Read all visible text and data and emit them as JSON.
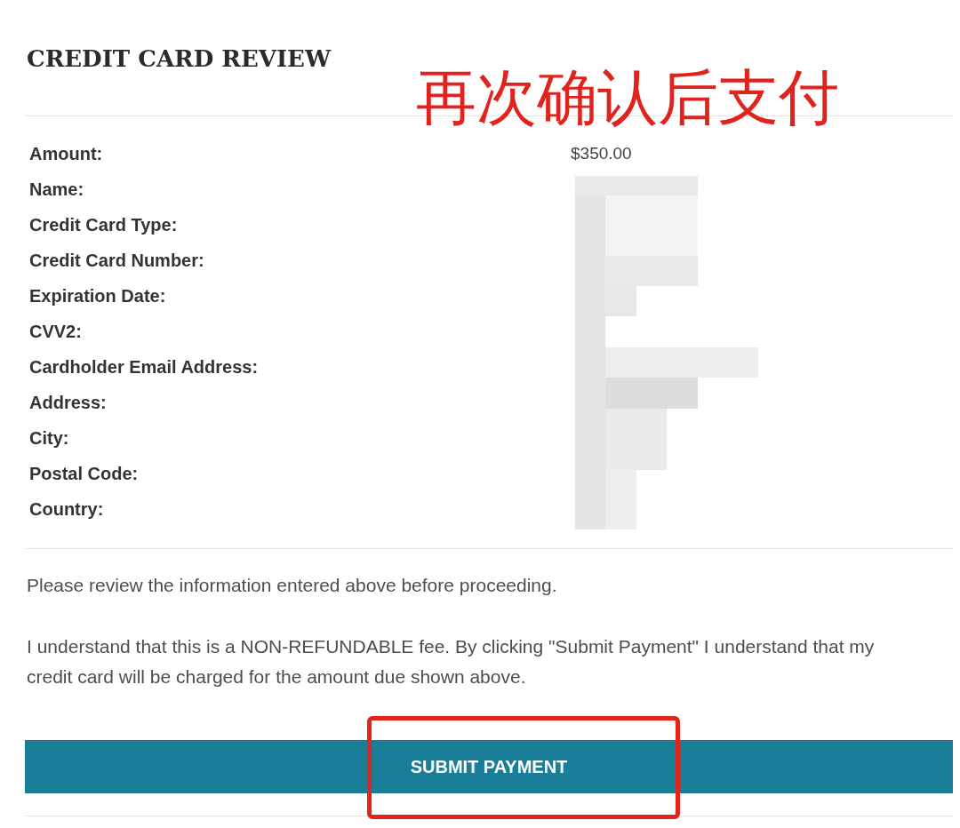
{
  "header": {
    "title": "CREDIT CARD REVIEW"
  },
  "annotation": {
    "text": "再次确认后支付"
  },
  "review": {
    "redacted": true,
    "rows": [
      {
        "label": "Amount:",
        "value": "$350.00"
      },
      {
        "label": "Name:"
      },
      {
        "label": "Credit Card Type:"
      },
      {
        "label": "Credit Card Number:"
      },
      {
        "label": "Expiration Date:"
      },
      {
        "label": "CVV2:"
      },
      {
        "label": "Cardholder Email Address:"
      },
      {
        "label": "Address:"
      },
      {
        "label": "City:"
      },
      {
        "label": "Postal Code:"
      },
      {
        "label": "Country:"
      }
    ]
  },
  "notices": [
    "Please review the information entered above before proceeding.",
    "I understand that this is a NON-REFUNDABLE fee. By clicking \"Submit Payment\" I understand that my credit card will be charged for the amount due shown above."
  ],
  "submit_button": {
    "label": "SUBMIT PAYMENT",
    "highlighted": true
  }
}
